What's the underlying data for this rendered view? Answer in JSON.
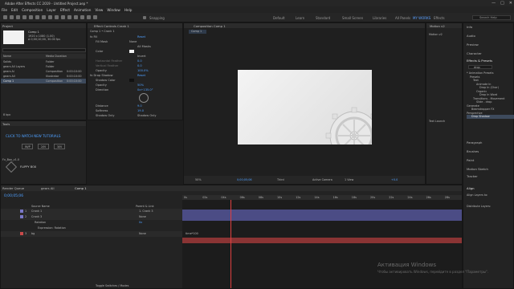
{
  "window": {
    "title": "Adobe After Effects CC 2019 - Untitled Project.aep *",
    "controls": [
      "—",
      "□",
      "✕"
    ]
  },
  "menu": [
    "File",
    "Edit",
    "Composition",
    "Layer",
    "Effect",
    "Animation",
    "View",
    "Window",
    "Help"
  ],
  "toolbar": {
    "snapping_label": "Snapping",
    "workspaces": [
      "Default",
      "Learn",
      "Standard",
      "Small Screen",
      "Libraries",
      "All Panels",
      "MY WORKS",
      "Effects"
    ],
    "search_placeholder": "Search Help"
  },
  "project_panel": {
    "tab": "Project",
    "comp_name": "Comp 1",
    "comp_info": "1920 x 1080 (1.00)",
    "comp_info2": "Δ 0;00;10;00, 30.00 fps",
    "col_name": "Name",
    "col_type": "Media Duration",
    "items": [
      {
        "name": "Solids",
        "type": "Folder",
        "dur": ""
      },
      {
        "name": "gears All Layers",
        "type": "Folder",
        "dur": ""
      },
      {
        "name": "gears Ai",
        "type": "Composition",
        "dur": "0:00:10:00"
      },
      {
        "name": "gears All",
        "type": "Illustrator",
        "dur": "0:00:10:00"
      },
      {
        "name": "Comp 1",
        "type": "Composition",
        "dur": "0:00:10:00"
      }
    ],
    "footer": "8 bpc"
  },
  "effect_controls": {
    "tab": "Effect Controls Crank 1",
    "breadcrumb": "Comp 1 • Crank 1",
    "effects": [
      {
        "label": "fx  Fill",
        "value": "Reset"
      },
      {
        "label": "Fill Mask",
        "value": "None"
      },
      {
        "label": "All Masks",
        "value": ""
      },
      {
        "label": "Color",
        "value": ""
      },
      {
        "label": "Invert",
        "value": ""
      },
      {
        "label": "Horizontal Feather",
        "value": "0.0"
      },
      {
        "label": "Vertical Feather",
        "value": "0.0"
      },
      {
        "label": "Opacity",
        "value": "100.0%"
      },
      {
        "label": "fx  Drop Shadow",
        "value": "Reset"
      },
      {
        "label": "Shadow Color",
        "value": ""
      },
      {
        "label": "Opacity",
        "value": "50%"
      },
      {
        "label": "Direction",
        "value": "0x+135.0°"
      },
      {
        "label": "Distance",
        "value": "9.0"
      },
      {
        "label": "Softness",
        "value": "19.0"
      },
      {
        "label": "Shadow Only",
        "value": "Shadow Only"
      }
    ]
  },
  "tutorials": {
    "tab": "Tools",
    "link": "CLICK TO WATCH NEW TUTORIALS",
    "buttons": [
      "IN/P",
      "2/N",
      "3/N"
    ],
    "script_name": "Fx_Box_v1.0",
    "brand": "FLIPPY BOX"
  },
  "composition_panel": {
    "tab": "Composition Comp 1",
    "sub_tab": "Comp 1",
    "zoom": "50%",
    "timecode": "0;00;05;06",
    "resolution": "Third",
    "camera": "Active Camera",
    "views": "1 View",
    "exposure": "+0.0"
  },
  "right_column": {
    "info_tab": "Motion v2",
    "tabs_top": [
      "Info",
      "Audio",
      "Preview",
      "Character",
      "Effects & Presets"
    ],
    "effects_search": "drop",
    "tree": [
      "* Animation Presets",
      "Presets",
      "Text",
      "Animate In",
      "Drop In (Char)",
      "Organic",
      "Drop In Word",
      "Transitions - Movement",
      "Slide - drop",
      "Generate",
      "Beamdropper FX",
      "Perspective",
      "Drop Shadow"
    ],
    "tabs_bottom": [
      "Paragraph",
      "Brushes",
      "Paint",
      "Motion Sketch",
      "Tracker"
    ],
    "align_tab": "Align",
    "align_to": "Align Layers to:",
    "distribute": "Distribute Layers:",
    "text_launch": "Text Launch"
  },
  "timeline": {
    "tabs": [
      "Render Queue",
      "gears All",
      "Comp 1"
    ],
    "timecode": "0;00;05;06",
    "columns": [
      "Source Name",
      "Parent & Link"
    ],
    "layers": [
      {
        "num": "1",
        "name": "Crank 1",
        "parent": "1. Crank 3",
        "color": "#7a78c8"
      },
      {
        "num": "2",
        "name": "Crank 3",
        "parent": "None",
        "color": "#7a78c8"
      },
      {
        "num": "",
        "name": "Rotation",
        "parent": "0x",
        "color": ""
      },
      {
        "num": "",
        "name": "Expression: Rotation",
        "parent": "",
        "color": ""
      },
      {
        "num": "3",
        "name": "bg",
        "parent": "None",
        "color": "#c84a4a"
      }
    ],
    "expression": "time*100",
    "ruler": [
      "0s",
      "02s",
      "04s",
      "06s",
      "08s",
      "10s",
      "12s",
      "14s",
      "16s",
      "18s",
      "20s",
      "22s",
      "24s",
      "26s",
      "28s"
    ],
    "footer": "Toggle Switches / Modes"
  },
  "watermark": {
    "title": "Активация Windows",
    "subtitle": "Чтобы активировать Windows, перейдите в раздел \"Параметры\"."
  }
}
